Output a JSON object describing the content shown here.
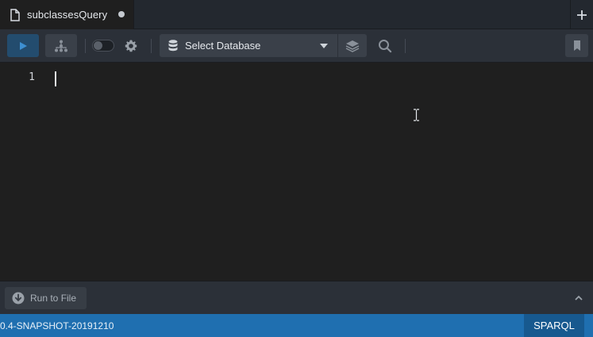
{
  "tab": {
    "title": "subclassesQuery",
    "modified": true
  },
  "toolbar": {
    "database_select": {
      "label": "Select Database"
    }
  },
  "editor": {
    "line_numbers": [
      "1"
    ],
    "content": ""
  },
  "bottom_panel": {
    "run_to_file_label": "Run to File"
  },
  "status_bar": {
    "version": "0.4-SNAPSHOT-20191210",
    "language": "SPARQL"
  },
  "colors": {
    "accent": "#1f6fb0",
    "run_button": "#234c6e"
  },
  "icons": [
    "file-icon",
    "unsaved-dot-icon",
    "plus-icon",
    "play-icon",
    "graph-icon",
    "toggle-switch",
    "gear-icon",
    "database-icon",
    "chevron-down-icon",
    "layers-icon",
    "search-icon",
    "bookmark-icon",
    "download-icon",
    "chevron-up-icon",
    "text-cursor-icon"
  ]
}
